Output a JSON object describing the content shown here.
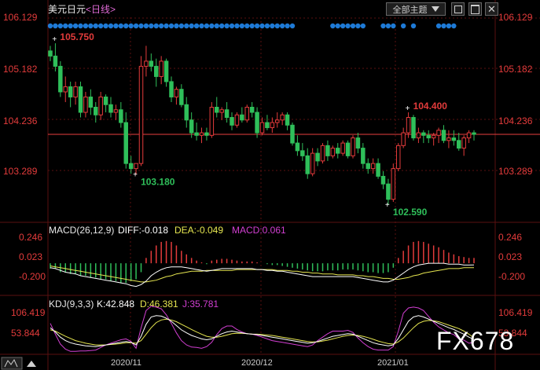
{
  "title": "美元日元",
  "period_label": "<日线>",
  "toolbar": {
    "theme_label": "全部主题",
    "dropdown_icon": "triangle-down-icon",
    "icons": [
      "window-restore-icon",
      "window-maximize-icon",
      "window-close-icon"
    ]
  },
  "watermark": "FX678",
  "colors": {
    "up": "#e33b3b",
    "down": "#2fbf5a",
    "bg": "#000000",
    "grid": "#5a1010",
    "axis_text": "#e33b3b",
    "dot": "#1e7ad6",
    "diff": "#ffffff",
    "dea": "#e6e650",
    "k": "#ffffff",
    "d": "#e6e650",
    "j": "#d23fd2",
    "last_price_line": "#e84040"
  },
  "chart_data": [
    {
      "type": "candlestick",
      "name": "price",
      "y_ticks": [
        "106.129",
        "105.182",
        "104.236",
        "103.289"
      ],
      "ylim": [
        102.45,
        106.35
      ],
      "x_ticks": [
        "2020/11",
        "2020/12",
        "2021/01"
      ],
      "last_price": 103.97,
      "annotations": [
        {
          "text": "105.750",
          "value": 105.75,
          "index": 1
        },
        {
          "text": "103.180",
          "value": 103.18,
          "index": 17
        },
        {
          "text": "104.400",
          "value": 104.4,
          "index": 71
        },
        {
          "text": "102.590",
          "value": 102.59,
          "index": 67
        }
      ],
      "candles": [
        [
          105.6,
          105.7,
          105.4,
          105.5
        ],
        [
          105.5,
          105.75,
          105.2,
          105.3
        ],
        [
          105.3,
          105.4,
          104.7,
          104.8
        ],
        [
          104.8,
          105.1,
          104.6,
          104.9
        ],
        [
          104.9,
          105.0,
          104.5,
          104.7
        ],
        [
          104.7,
          105.0,
          104.55,
          104.9
        ],
        [
          104.9,
          105.0,
          104.3,
          104.4
        ],
        [
          104.4,
          104.8,
          104.3,
          104.7
        ],
        [
          104.7,
          104.85,
          104.35,
          104.5
        ],
        [
          104.5,
          104.6,
          104.2,
          104.35
        ],
        [
          104.35,
          104.8,
          104.25,
          104.7
        ],
        [
          104.7,
          104.75,
          104.4,
          104.55
        ],
        [
          104.55,
          104.7,
          104.3,
          104.4
        ],
        [
          104.4,
          104.55,
          104.25,
          104.45
        ],
        [
          104.45,
          104.6,
          104.1,
          104.2
        ],
        [
          104.2,
          104.4,
          103.3,
          103.4
        ],
        [
          103.4,
          103.55,
          103.2,
          103.3
        ],
        [
          103.3,
          103.4,
          103.18,
          103.4
        ],
        [
          103.4,
          105.5,
          103.35,
          105.3
        ],
        [
          105.3,
          105.7,
          105.1,
          105.4
        ],
        [
          105.4,
          105.55,
          105.2,
          105.3
        ],
        [
          105.3,
          105.45,
          104.9,
          105.1
        ],
        [
          105.1,
          105.5,
          104.95,
          105.4
        ],
        [
          105.4,
          105.45,
          104.9,
          105.0
        ],
        [
          105.0,
          105.1,
          104.6,
          104.7
        ],
        [
          104.7,
          104.9,
          104.55,
          104.85
        ],
        [
          104.85,
          104.95,
          104.5,
          104.55
        ],
        [
          104.55,
          104.7,
          104.1,
          104.25
        ],
        [
          104.25,
          104.4,
          103.9,
          104.0
        ],
        [
          104.0,
          104.2,
          103.85,
          103.95
        ],
        [
          103.95,
          104.1,
          103.8,
          104.0
        ],
        [
          104.0,
          104.1,
          103.85,
          103.95
        ],
        [
          103.95,
          104.6,
          103.9,
          104.5
        ],
        [
          104.5,
          104.7,
          104.3,
          104.4
        ],
        [
          104.4,
          104.5,
          104.25,
          104.45
        ],
        [
          104.45,
          104.6,
          104.2,
          104.3
        ],
        [
          104.3,
          104.4,
          104.05,
          104.15
        ],
        [
          104.15,
          104.4,
          104.1,
          104.35
        ],
        [
          104.35,
          104.5,
          104.2,
          104.25
        ],
        [
          104.25,
          104.55,
          104.2,
          104.5
        ],
        [
          104.5,
          104.6,
          104.3,
          104.4
        ],
        [
          104.4,
          104.5,
          103.9,
          104.0
        ],
        [
          104.0,
          104.3,
          103.95,
          104.2
        ],
        [
          104.2,
          104.35,
          104.05,
          104.1
        ],
        [
          104.1,
          104.3,
          104.0,
          104.2
        ],
        [
          104.2,
          104.4,
          104.1,
          104.25
        ],
        [
          104.25,
          104.4,
          104.15,
          104.35
        ],
        [
          104.35,
          104.4,
          104.05,
          104.15
        ],
        [
          104.15,
          104.2,
          103.75,
          103.8
        ],
        [
          103.8,
          103.95,
          103.55,
          103.65
        ],
        [
          103.65,
          103.8,
          103.45,
          103.55
        ],
        [
          103.55,
          103.7,
          103.1,
          103.2
        ],
        [
          103.2,
          103.7,
          103.15,
          103.6
        ],
        [
          103.6,
          103.7,
          103.35,
          103.45
        ],
        [
          103.45,
          103.8,
          103.4,
          103.75
        ],
        [
          103.75,
          103.85,
          103.45,
          103.55
        ],
        [
          103.55,
          103.75,
          103.5,
          103.7
        ],
        [
          103.7,
          103.8,
          103.5,
          103.6
        ],
        [
          103.6,
          103.85,
          103.55,
          103.8
        ],
        [
          103.8,
          103.85,
          103.5,
          103.55
        ],
        [
          103.55,
          103.95,
          103.5,
          103.9
        ],
        [
          103.9,
          104.0,
          103.6,
          103.7
        ],
        [
          103.7,
          103.8,
          103.3,
          103.4
        ],
        [
          103.4,
          103.5,
          103.2,
          103.3
        ],
        [
          103.3,
          103.5,
          103.2,
          103.4
        ],
        [
          103.4,
          103.5,
          103.1,
          103.15
        ],
        [
          103.15,
          103.25,
          102.9,
          103.0
        ],
        [
          103.0,
          103.1,
          102.59,
          102.7
        ],
        [
          102.7,
          103.4,
          102.65,
          103.3
        ],
        [
          103.3,
          103.8,
          103.25,
          103.75
        ],
        [
          103.75,
          104.1,
          103.7,
          104.0
        ],
        [
          104.0,
          104.4,
          103.9,
          104.3
        ],
        [
          104.3,
          104.35,
          103.85,
          103.9
        ],
        [
          103.9,
          104.1,
          103.8,
          104.0
        ],
        [
          104.0,
          104.05,
          103.8,
          103.95
        ],
        [
          103.95,
          104.05,
          103.8,
          103.9
        ],
        [
          103.9,
          104.0,
          103.75,
          103.95
        ],
        [
          103.95,
          104.1,
          103.8,
          104.05
        ],
        [
          104.05,
          104.15,
          103.8,
          103.85
        ],
        [
          103.85,
          104.05,
          103.7,
          103.9
        ],
        [
          103.9,
          104.05,
          103.75,
          103.85
        ],
        [
          103.85,
          104.0,
          103.65,
          103.7
        ],
        [
          103.7,
          103.95,
          103.55,
          103.9
        ],
        [
          103.9,
          104.05,
          103.8,
          104.0
        ],
        [
          104.0,
          104.05,
          103.85,
          103.97
        ]
      ]
    },
    {
      "type": "bar",
      "name": "MACD",
      "header": {
        "label": "MACD(26,12,9)",
        "diff": "DIFF:-0.018",
        "dea": "DEA:-0.049",
        "macd": "MACD:0.061"
      },
      "y_ticks": [
        "0.246",
        "0.023",
        "-0.200"
      ],
      "ylim": [
        -0.29,
        0.31
      ],
      "histogram": [
        -0.06,
        -0.06,
        -0.1,
        -0.1,
        -0.12,
        -0.12,
        -0.14,
        -0.14,
        -0.16,
        -0.16,
        -0.18,
        -0.18,
        -0.2,
        -0.2,
        -0.22,
        -0.22,
        -0.2,
        -0.18,
        -0.1,
        0.06,
        0.14,
        0.2,
        0.24,
        0.25,
        0.24,
        0.2,
        0.14,
        0.1,
        0.06,
        0.03,
        0.01,
        -0.01,
        0.03,
        0.04,
        0.05,
        0.05,
        0.04,
        0.03,
        0.02,
        0.02,
        0.02,
        0.01,
        0.0,
        -0.01,
        -0.02,
        -0.02,
        -0.03,
        -0.04,
        -0.05,
        -0.06,
        -0.07,
        -0.08,
        -0.09,
        -0.09,
        -0.09,
        -0.08,
        -0.08,
        -0.08,
        -0.07,
        -0.07,
        -0.07,
        -0.08,
        -0.09,
        -0.1,
        -0.1,
        -0.11,
        -0.11,
        -0.1,
        -0.05,
        0.06,
        0.14,
        0.2,
        0.24,
        0.25,
        0.24,
        0.22,
        0.2,
        0.18,
        0.15,
        0.12,
        0.1,
        0.08,
        0.07,
        0.06,
        0.06
      ],
      "diff": [
        -0.05,
        -0.06,
        -0.08,
        -0.1,
        -0.11,
        -0.12,
        -0.14,
        -0.15,
        -0.16,
        -0.17,
        -0.18,
        -0.19,
        -0.2,
        -0.21,
        -0.22,
        -0.23,
        -0.25,
        -0.26,
        -0.24,
        -0.2,
        -0.14,
        -0.1,
        -0.07,
        -0.05,
        -0.04,
        -0.04,
        -0.04,
        -0.05,
        -0.06,
        -0.07,
        -0.08,
        -0.09,
        -0.08,
        -0.07,
        -0.06,
        -0.06,
        -0.06,
        -0.06,
        -0.06,
        -0.06,
        -0.06,
        -0.07,
        -0.07,
        -0.08,
        -0.08,
        -0.09,
        -0.09,
        -0.1,
        -0.11,
        -0.12,
        -0.13,
        -0.14,
        -0.15,
        -0.15,
        -0.15,
        -0.15,
        -0.15,
        -0.15,
        -0.15,
        -0.15,
        -0.15,
        -0.16,
        -0.17,
        -0.18,
        -0.19,
        -0.2,
        -0.21,
        -0.21,
        -0.19,
        -0.15,
        -0.11,
        -0.07,
        -0.04,
        -0.02,
        -0.01,
        0.0,
        0.0,
        0.0,
        0.0,
        -0.01,
        -0.01,
        -0.01,
        -0.02,
        -0.02,
        -0.018
      ],
      "dea": [
        -0.03,
        -0.04,
        -0.05,
        -0.06,
        -0.07,
        -0.08,
        -0.09,
        -0.1,
        -0.11,
        -0.12,
        -0.13,
        -0.14,
        -0.15,
        -0.16,
        -0.17,
        -0.18,
        -0.19,
        -0.2,
        -0.21,
        -0.21,
        -0.2,
        -0.19,
        -0.17,
        -0.15,
        -0.14,
        -0.12,
        -0.11,
        -0.1,
        -0.09,
        -0.09,
        -0.09,
        -0.08,
        -0.08,
        -0.08,
        -0.08,
        -0.08,
        -0.08,
        -0.07,
        -0.07,
        -0.07,
        -0.07,
        -0.07,
        -0.07,
        -0.07,
        -0.07,
        -0.08,
        -0.08,
        -0.08,
        -0.09,
        -0.09,
        -0.1,
        -0.1,
        -0.11,
        -0.11,
        -0.12,
        -0.12,
        -0.12,
        -0.13,
        -0.13,
        -0.13,
        -0.13,
        -0.14,
        -0.14,
        -0.15,
        -0.15,
        -0.16,
        -0.17,
        -0.17,
        -0.18,
        -0.18,
        -0.17,
        -0.16,
        -0.14,
        -0.13,
        -0.11,
        -0.1,
        -0.09,
        -0.08,
        -0.07,
        -0.06,
        -0.06,
        -0.06,
        -0.05,
        -0.05,
        -0.049
      ]
    },
    {
      "type": "line",
      "name": "KDJ",
      "header": {
        "label": "KDJ(9,3,3)",
        "k": "K:42.848",
        "d": "D:46.381",
        "j": "J:35.781"
      },
      "y_ticks": [
        "106.419",
        "53.844"
      ],
      "ylim": [
        10,
        116
      ],
      "k": [
        70,
        60,
        48,
        40,
        35,
        32,
        30,
        28,
        27,
        26,
        28,
        30,
        32,
        34,
        36,
        38,
        36,
        30,
        50,
        78,
        95,
        98,
        97,
        92,
        85,
        75,
        65,
        58,
        52,
        48,
        44,
        42,
        44,
        50,
        56,
        60,
        62,
        60,
        58,
        56,
        55,
        54,
        52,
        50,
        48,
        46,
        44,
        42,
        40,
        38,
        36,
        34,
        35,
        38,
        42,
        46,
        50,
        52,
        54,
        56,
        55,
        50,
        45,
        40,
        35,
        32,
        30,
        28,
        30,
        45,
        65,
        85,
        95,
        98,
        95,
        90,
        85,
        80,
        75,
        70,
        66,
        60,
        55,
        48,
        42.848
      ],
      "d": [
        65,
        62,
        56,
        50,
        45,
        40,
        37,
        34,
        32,
        30,
        30,
        30,
        31,
        32,
        33,
        35,
        35,
        34,
        40,
        55,
        70,
        82,
        88,
        90,
        88,
        84,
        78,
        72,
        66,
        60,
        55,
        50,
        48,
        48,
        50,
        53,
        56,
        57,
        57,
        56,
        55,
        55,
        54,
        53,
        52,
        50,
        48,
        46,
        44,
        42,
        40,
        38,
        37,
        37,
        39,
        41,
        44,
        47,
        50,
        52,
        53,
        52,
        50,
        47,
        43,
        39,
        36,
        33,
        32,
        37,
        46,
        58,
        70,
        80,
        85,
        87,
        86,
        84,
        80,
        76,
        72,
        68,
        62,
        55,
        46.381
      ],
      "j": [
        80,
        55,
        32,
        20,
        15,
        15,
        16,
        16,
        17,
        18,
        24,
        30,
        34,
        38,
        42,
        44,
        38,
        22,
        70,
        110,
        120,
        118,
        114,
        100,
        80,
        58,
        40,
        30,
        25,
        24,
        22,
        26,
        36,
        54,
        68,
        74,
        74,
        66,
        60,
        56,
        55,
        52,
        48,
        44,
        40,
        38,
        36,
        34,
        32,
        30,
        28,
        26,
        30,
        40,
        48,
        56,
        62,
        62,
        62,
        64,
        59,
        46,
        35,
        26,
        20,
        18,
        18,
        18,
        26,
        62,
        104,
        116,
        118,
        116,
        110,
        96,
        83,
        72,
        65,
        58,
        54,
        44,
        41,
        34,
        35.781
      ]
    }
  ]
}
